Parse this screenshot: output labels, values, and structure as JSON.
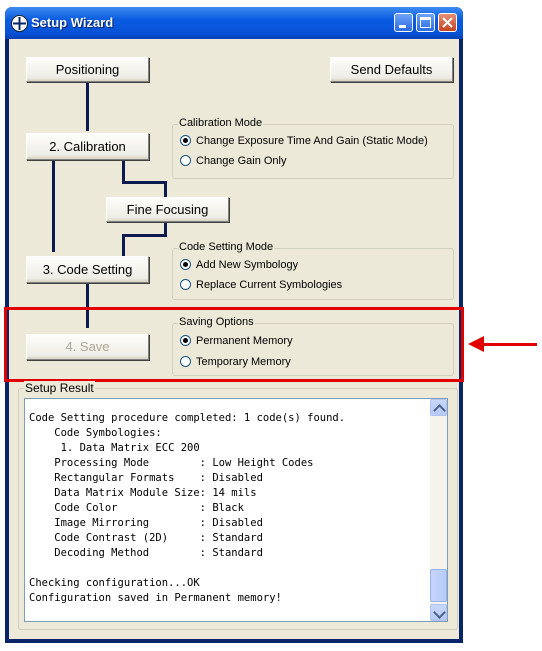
{
  "window": {
    "title": "Setup Wizard"
  },
  "buttons": {
    "positioning": "Positioning",
    "send_defaults": "Send Defaults",
    "calibration": "2. Calibration",
    "fine_focusing": "Fine Focusing",
    "code_setting": "3. Code Setting",
    "save": "4. Save"
  },
  "calibration_mode": {
    "legend": "Calibration Mode",
    "options": [
      {
        "label": "Change Exposure Time And Gain (Static Mode)",
        "selected": true
      },
      {
        "label": "Change Gain Only",
        "selected": false
      }
    ]
  },
  "code_setting_mode": {
    "legend": "Code Setting Mode",
    "options": [
      {
        "label": "Add New Symbology",
        "selected": true
      },
      {
        "label": "Replace Current Symbologies",
        "selected": false
      }
    ]
  },
  "saving_options": {
    "legend": "Saving Options",
    "options": [
      {
        "label": "Permanent Memory",
        "selected": true
      },
      {
        "label": "Temporary Memory",
        "selected": false
      }
    ]
  },
  "setup_result": {
    "label": "Setup Result",
    "lines": [
      "Code Setting procedure completed: 1 code(s) found.",
      "    Code Symbologies:",
      "     1. Data Matrix ECC 200",
      "    Processing Mode        : Low Height Codes",
      "    Rectangular Formats    : Disabled",
      "    Data Matrix Module Size: 14 mils",
      "    Code Color             : Black",
      "    Image Mirroring        : Disabled",
      "    Code Contrast (2D)     : Standard",
      "    Decoding Method        : Standard",
      "",
      "Checking configuration...OK",
      "Configuration saved in Permanent memory!"
    ]
  },
  "colors": {
    "highlight": "#e00000",
    "title_bar": "#0a5be0",
    "dialog_bg": "#ece9d8"
  }
}
